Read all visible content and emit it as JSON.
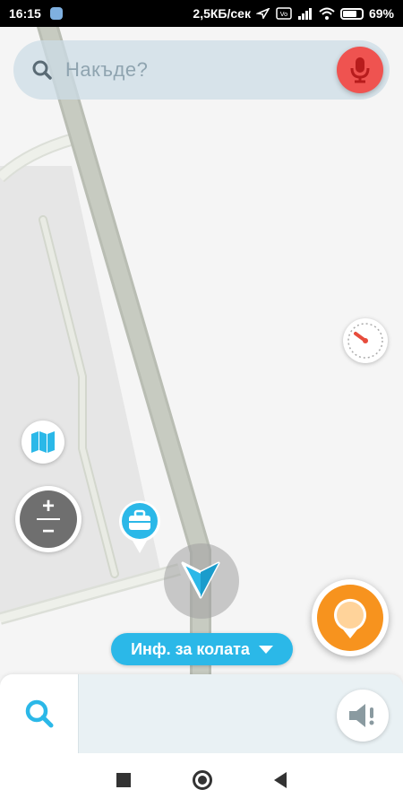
{
  "status_bar": {
    "time": "16:15",
    "network_speed": "2,5КБ/сек",
    "battery": "69%"
  },
  "search": {
    "placeholder": "Накъде?"
  },
  "car_info": {
    "label": "Инф. за колата"
  },
  "colors": {
    "accent": "#2bb8e8",
    "mic": "#ef5350",
    "report": "#f7931e",
    "road": "#c4c8bf"
  },
  "icons": {
    "search": "search-icon",
    "mic": "microphone-icon",
    "compass": "speedometer-icon",
    "map": "map-icon",
    "work": "briefcase-icon",
    "report": "report-icon",
    "sound": "speaker-icon"
  }
}
